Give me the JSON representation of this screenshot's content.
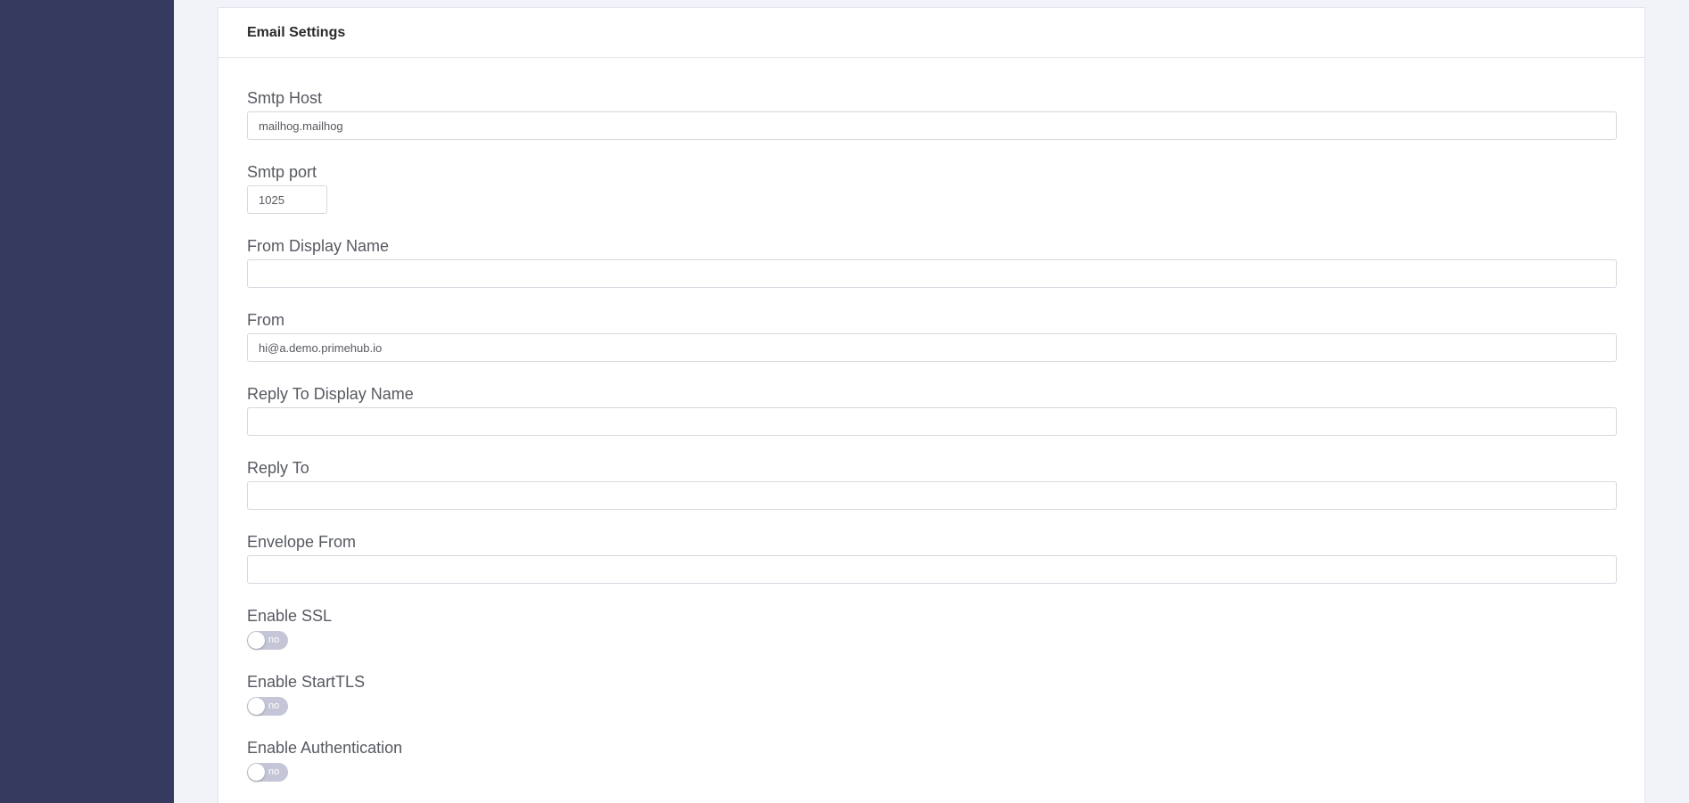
{
  "email_settings": {
    "title": "Email Settings",
    "smtp_host": {
      "label": "Smtp Host",
      "value": "mailhog.mailhog"
    },
    "smtp_port": {
      "label": "Smtp port",
      "value": "1025"
    },
    "from_display_name": {
      "label": "From Display Name",
      "value": ""
    },
    "from": {
      "label": "From",
      "value": "hi@a.demo.primehub.io"
    },
    "reply_to_display_name": {
      "label": "Reply To Display Name",
      "value": ""
    },
    "reply_to": {
      "label": "Reply To",
      "value": ""
    },
    "envelope_from": {
      "label": "Envelope From",
      "value": ""
    },
    "enable_ssl": {
      "label": "Enable SSL",
      "state": "no"
    },
    "enable_starttls": {
      "label": "Enable StartTLS",
      "state": "no"
    },
    "enable_authentication": {
      "label": "Enable Authentication",
      "state": "no"
    }
  },
  "colors": {
    "sidebar": "#363a5f",
    "page_background": "#f2f3f8",
    "toggle_off": "#c4c5d6"
  }
}
